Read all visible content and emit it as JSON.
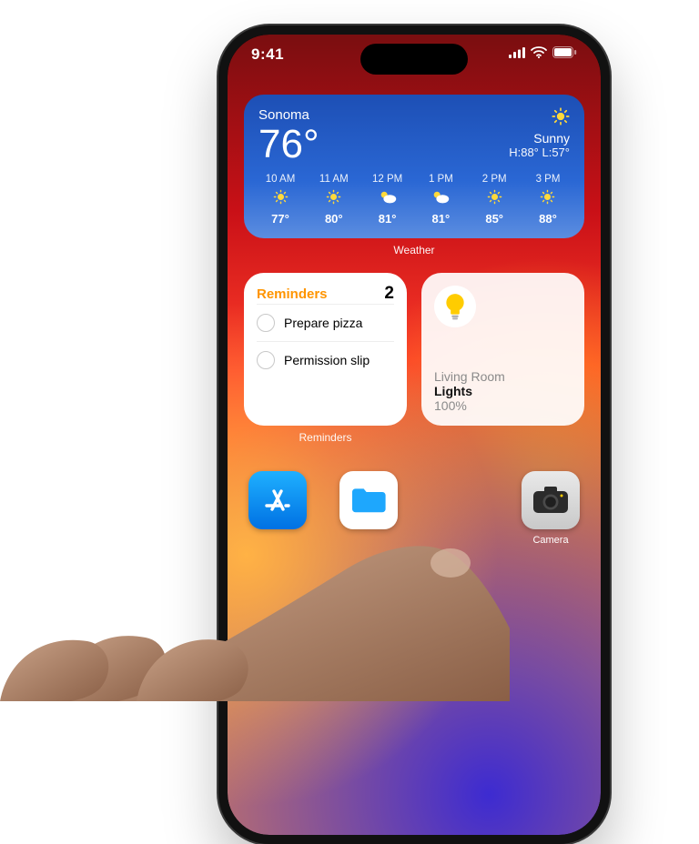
{
  "status": {
    "time": "9:41"
  },
  "weather": {
    "location": "Sonoma",
    "temp": "76°",
    "condition": "Sunny",
    "hi": "88°",
    "lo": "57°",
    "hilo_label": "H:88° L:57°",
    "hours": [
      {
        "label": "10 AM",
        "icon": "sun",
        "temp": "77°"
      },
      {
        "label": "11 AM",
        "icon": "sun",
        "temp": "80°"
      },
      {
        "label": "12 PM",
        "icon": "partly",
        "temp": "81°"
      },
      {
        "label": "1 PM",
        "icon": "partly",
        "temp": "81°"
      },
      {
        "label": "2 PM",
        "icon": "sun",
        "temp": "85°"
      },
      {
        "label": "3 PM",
        "icon": "sun",
        "temp": "88°"
      }
    ],
    "caption": "Weather"
  },
  "reminders": {
    "title": "Reminders",
    "count": "2",
    "items": [
      {
        "text": "Prepare pizza"
      },
      {
        "text": "Permission slip"
      }
    ],
    "caption": "Reminders"
  },
  "home": {
    "room": "Living Room",
    "accessory": "Lights",
    "value": "100%"
  },
  "apps": {
    "camera_label": "Camera"
  }
}
